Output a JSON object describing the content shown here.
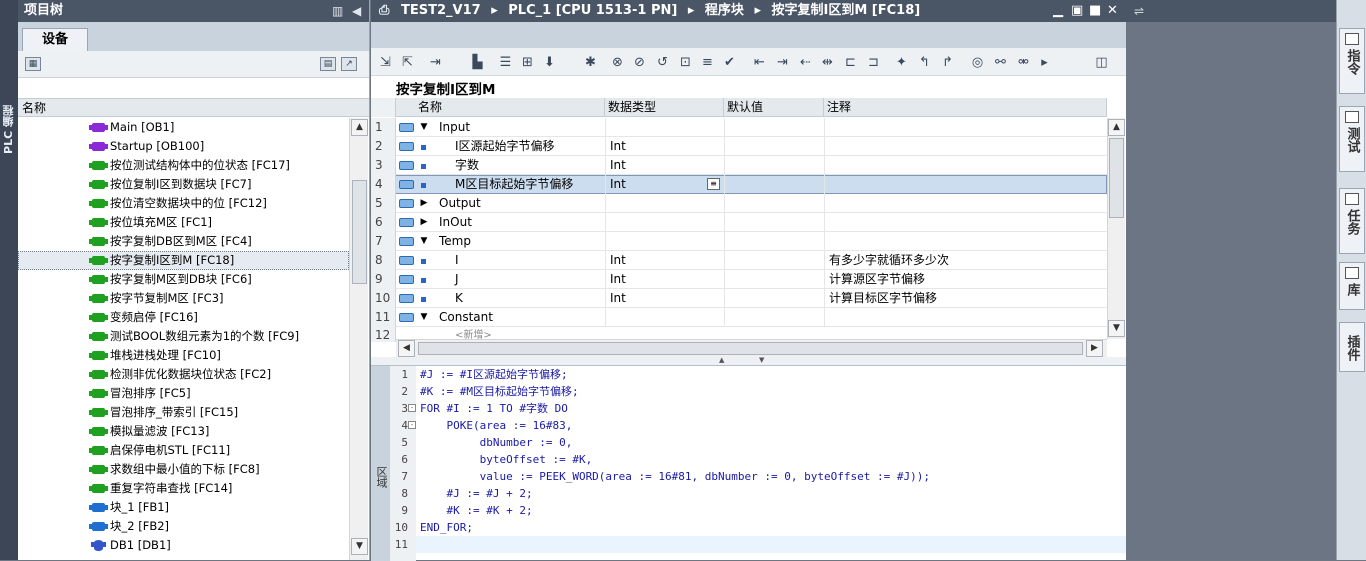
{
  "left_side": {
    "label": "PLC 编程"
  },
  "tree": {
    "title": "项目树",
    "tab": "设备",
    "column": "名称",
    "items": [
      {
        "label": "Main [OB1]",
        "type": "ob"
      },
      {
        "label": "Startup [OB100]",
        "type": "ob"
      },
      {
        "label": "按位测试结构体中的位状态 [FC17]",
        "type": "fc"
      },
      {
        "label": "按位复制I区到数据块 [FC7]",
        "type": "fc"
      },
      {
        "label": "按位清空数据块中的位 [FC12]",
        "type": "fc"
      },
      {
        "label": "按位填充M区 [FC1]",
        "type": "fc"
      },
      {
        "label": "按字复制DB区到M区 [FC4]",
        "type": "fc"
      },
      {
        "label": "按字复制I区到M [FC18]",
        "type": "fc",
        "selected": true
      },
      {
        "label": "按字复制M区到DB块 [FC6]",
        "type": "fc"
      },
      {
        "label": "按字节复制M区 [FC3]",
        "type": "fc"
      },
      {
        "label": "变频启停 [FC16]",
        "type": "fc"
      },
      {
        "label": "测试BOOL数组元素为1的个数 [FC9]",
        "type": "fc"
      },
      {
        "label": "堆栈进栈处理 [FC10]",
        "type": "fc"
      },
      {
        "label": "检测非优化数据块位状态 [FC2]",
        "type": "fc"
      },
      {
        "label": "冒泡排序 [FC5]",
        "type": "fc"
      },
      {
        "label": "冒泡排序_带索引 [FC15]",
        "type": "fc"
      },
      {
        "label": "模拟量滤波 [FC13]",
        "type": "fc"
      },
      {
        "label": "启保停电机STL [FC11]",
        "type": "fc"
      },
      {
        "label": "求数组中最小值的下标 [FC8]",
        "type": "fc"
      },
      {
        "label": "重复字符串查找 [FC14]",
        "type": "fc"
      },
      {
        "label": "块_1 [FB1]",
        "type": "fb"
      },
      {
        "label": "块_2 [FB2]",
        "type": "fb"
      },
      {
        "label": "DB1 [DB1]",
        "type": "db"
      }
    ],
    "colors": {
      "ob": "#8a2bd6",
      "fc": "#20a020",
      "fb": "#1e6fd0",
      "db": "#3355cc"
    }
  },
  "editor": {
    "breadcrumb": [
      "TEST2_V17",
      "PLC_1 [CPU 1513-1 PN]",
      "程序块",
      "按字复制I区到M [FC18]"
    ],
    "block_name": "按字复制I区到M",
    "headers": {
      "name": "名称",
      "type": "数据类型",
      "default": "默认值",
      "comment": "注释"
    },
    "rows": [
      {
        "n": "1",
        "exp": "▼",
        "name": "Input",
        "indent": 0,
        "type": "",
        "comment": ""
      },
      {
        "n": "2",
        "exp": "",
        "name": "I区源起始字节偏移",
        "indent": 1,
        "type": "Int",
        "comment": ""
      },
      {
        "n": "3",
        "exp": "",
        "name": "字数",
        "indent": 1,
        "type": "Int",
        "comment": ""
      },
      {
        "n": "4",
        "exp": "",
        "name": "M区目标起始字节偏移",
        "indent": 1,
        "type": "Int",
        "comment": "",
        "selected": true
      },
      {
        "n": "5",
        "exp": "▶",
        "name": "Output",
        "indent": 0,
        "type": "",
        "comment": ""
      },
      {
        "n": "6",
        "exp": "▶",
        "name": "InOut",
        "indent": 0,
        "type": "",
        "comment": ""
      },
      {
        "n": "7",
        "exp": "▼",
        "name": "Temp",
        "indent": 0,
        "type": "",
        "comment": ""
      },
      {
        "n": "8",
        "exp": "",
        "name": "I",
        "indent": 1,
        "type": "Int",
        "comment": "有多少字就循环多少次"
      },
      {
        "n": "9",
        "exp": "",
        "name": "J",
        "indent": 1,
        "type": "Int",
        "comment": "计算源区字节偏移"
      },
      {
        "n": "10",
        "exp": "",
        "name": "K",
        "indent": 1,
        "type": "Int",
        "comment": "计算目标区字节偏移"
      },
      {
        "n": "11",
        "exp": "▼",
        "name": "Constant",
        "indent": 0,
        "type": "",
        "comment": ""
      }
    ],
    "code_side_label": "区域",
    "code": [
      {
        "n": "1",
        "fold": "",
        "text": "#J := #I区源起始字节偏移;"
      },
      {
        "n": "2",
        "fold": "",
        "text": "#K := #M区目标起始字节偏移;"
      },
      {
        "n": "3",
        "fold": "-",
        "text": "FOR #I := 1 TO #字数 DO"
      },
      {
        "n": "4",
        "fold": "-",
        "text": "    POKE(area := 16#83,"
      },
      {
        "n": "5",
        "fold": "",
        "text": "         dbNumber := 0,"
      },
      {
        "n": "6",
        "fold": "",
        "text": "         byteOffset := #K,"
      },
      {
        "n": "7",
        "fold": "",
        "text": "         value := PEEK_WORD(area := 16#81, dbNumber := 0, byteOffset := #J));"
      },
      {
        "n": "8",
        "fold": "",
        "text": "    #J := #J + 2;"
      },
      {
        "n": "9",
        "fold": "",
        "text": "    #K := #K + 2;"
      },
      {
        "n": "10",
        "fold": "",
        "text": "END_FOR;"
      },
      {
        "n": "11",
        "fold": "",
        "text": ""
      }
    ]
  },
  "right_tabs": [
    "指令",
    "测试",
    "任务",
    "库",
    "插件"
  ]
}
